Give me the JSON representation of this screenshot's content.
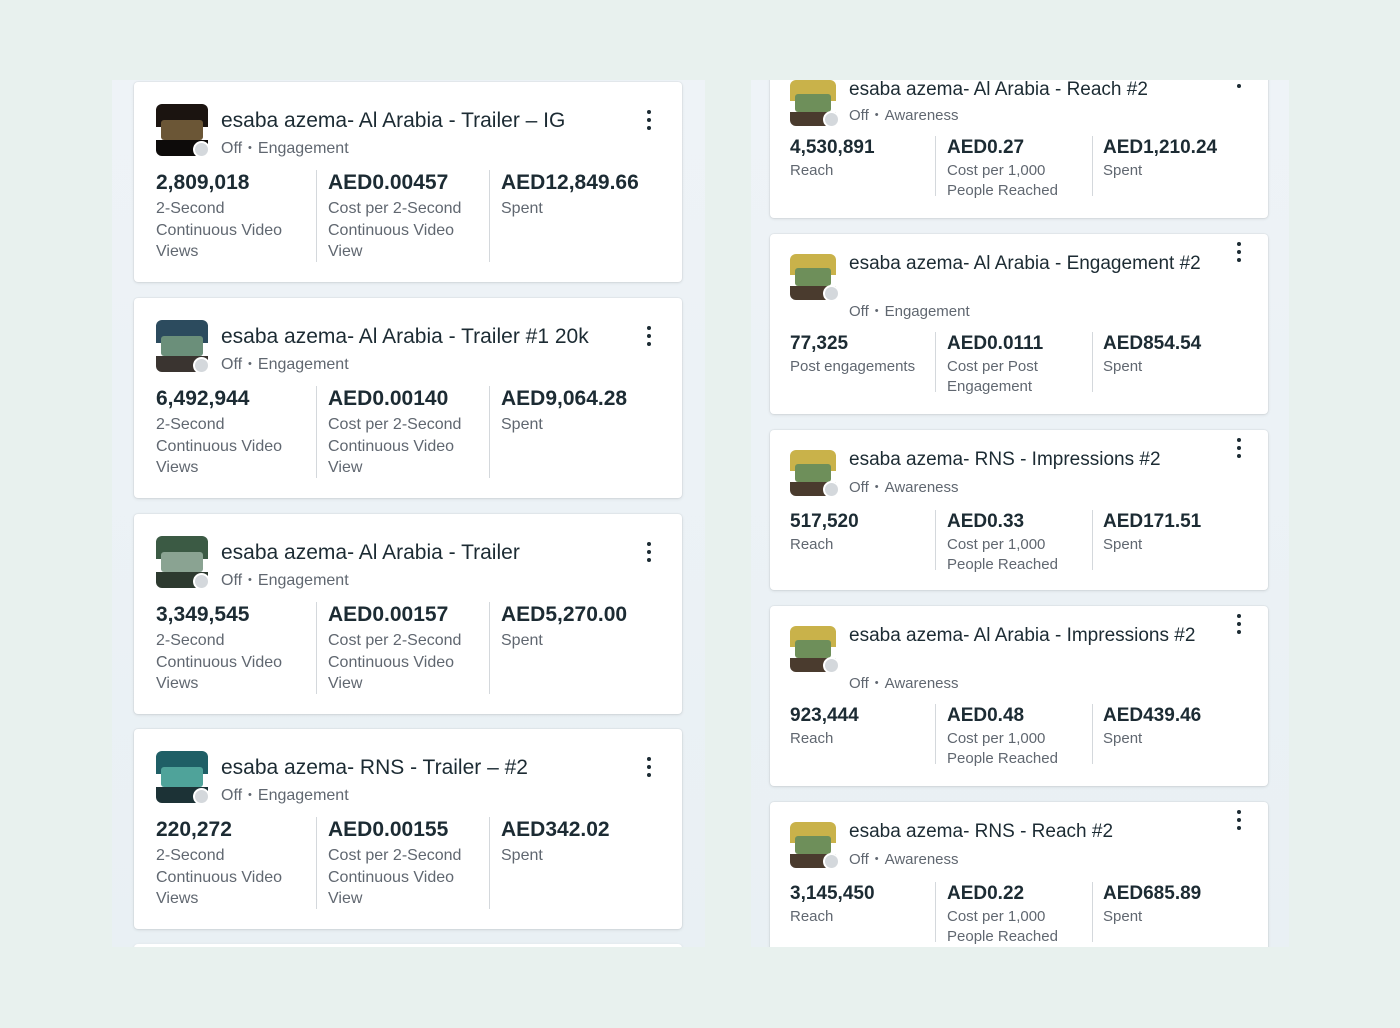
{
  "left_cards": [
    {
      "title": "esaba azema- Al Arabia - Trailer  – IG",
      "status": "Off",
      "objective": "Engagement",
      "metrics": [
        {
          "value": "2,809,018",
          "label": "2-Second Continuous Video Views"
        },
        {
          "value": "AED0.00457",
          "label": "Cost per 2-Second Continuous Video View"
        },
        {
          "value": "AED12,849.66",
          "label": "Spent"
        }
      ]
    },
    {
      "title": "esaba azema- Al Arabia - Trailer #1 20k",
      "status": "Off",
      "objective": "Engagement",
      "metrics": [
        {
          "value": "6,492,944",
          "label": "2-Second Continuous Video Views"
        },
        {
          "value": "AED0.00140",
          "label": "Cost per 2-Second Continuous Video View"
        },
        {
          "value": "AED9,064.28",
          "label": "Spent"
        }
      ]
    },
    {
      "title": "esaba azema- Al Arabia - Trailer",
      "status": "Off",
      "objective": "Engagement",
      "metrics": [
        {
          "value": "3,349,545",
          "label": "2-Second Continuous Video Views"
        },
        {
          "value": "AED0.00157",
          "label": "Cost per 2-Second Continuous Video View"
        },
        {
          "value": "AED5,270.00",
          "label": "Spent"
        }
      ]
    },
    {
      "title": "esaba azema- RNS - Trailer – #2",
      "status": "Off",
      "objective": "Engagement",
      "metrics": [
        {
          "value": "220,272",
          "label": "2-Second Continuous Video Views"
        },
        {
          "value": "AED0.00155",
          "label": "Cost per 2-Second Continuous Video View"
        },
        {
          "value": "AED342.02",
          "label": "Spent"
        }
      ]
    }
  ],
  "right_cards": [
    {
      "title": "esaba azema- Al Arabia - Reach #2",
      "status": "Off",
      "objective": "Awareness",
      "metrics": [
        {
          "value": "4,530,891",
          "label": "Reach"
        },
        {
          "value": "AED0.27",
          "label": "Cost per 1,000 People Reached"
        },
        {
          "value": "AED1,210.24",
          "label": "Spent"
        }
      ]
    },
    {
      "title": "esaba azema- Al Arabia - Engagement #2",
      "status": "Off",
      "objective": "Engagement",
      "metrics": [
        {
          "value": "77,325",
          "label": "Post engagements"
        },
        {
          "value": "AED0.0111",
          "label": "Cost per Post Engagement"
        },
        {
          "value": "AED854.54",
          "label": "Spent"
        }
      ]
    },
    {
      "title": "esaba azema- RNS - Impressions #2",
      "status": "Off",
      "objective": "Awareness",
      "metrics": [
        {
          "value": "517,520",
          "label": "Reach"
        },
        {
          "value": "AED0.33",
          "label": "Cost per 1,000 People Reached"
        },
        {
          "value": "AED171.51",
          "label": "Spent"
        }
      ]
    },
    {
      "title": "esaba azema- Al Arabia - Impressions #2",
      "status": "Off",
      "objective": "Awareness",
      "metrics": [
        {
          "value": "923,444",
          "label": "Reach"
        },
        {
          "value": "AED0.48",
          "label": "Cost per 1,000 People Reached"
        },
        {
          "value": "AED439.46",
          "label": "Spent"
        }
      ]
    },
    {
      "title": "esaba azema- RNS - Reach #2",
      "status": "Off",
      "objective": "Awareness",
      "metrics": [
        {
          "value": "3,145,450",
          "label": "Reach"
        },
        {
          "value": "AED0.22",
          "label": "Cost per 1,000 People Reached"
        },
        {
          "value": "AED685.89",
          "label": "Spent"
        }
      ]
    }
  ],
  "separator": "•",
  "icons": {
    "menu": "more-vertical-icon",
    "status": "status-dot-icon"
  },
  "colors": {
    "background": "#e8f1ee",
    "panel": "#eef3f7",
    "card": "#ffffff",
    "text_primary": "#1c2b33",
    "text_secondary": "#606770",
    "status_off": "#d4d8dc"
  }
}
